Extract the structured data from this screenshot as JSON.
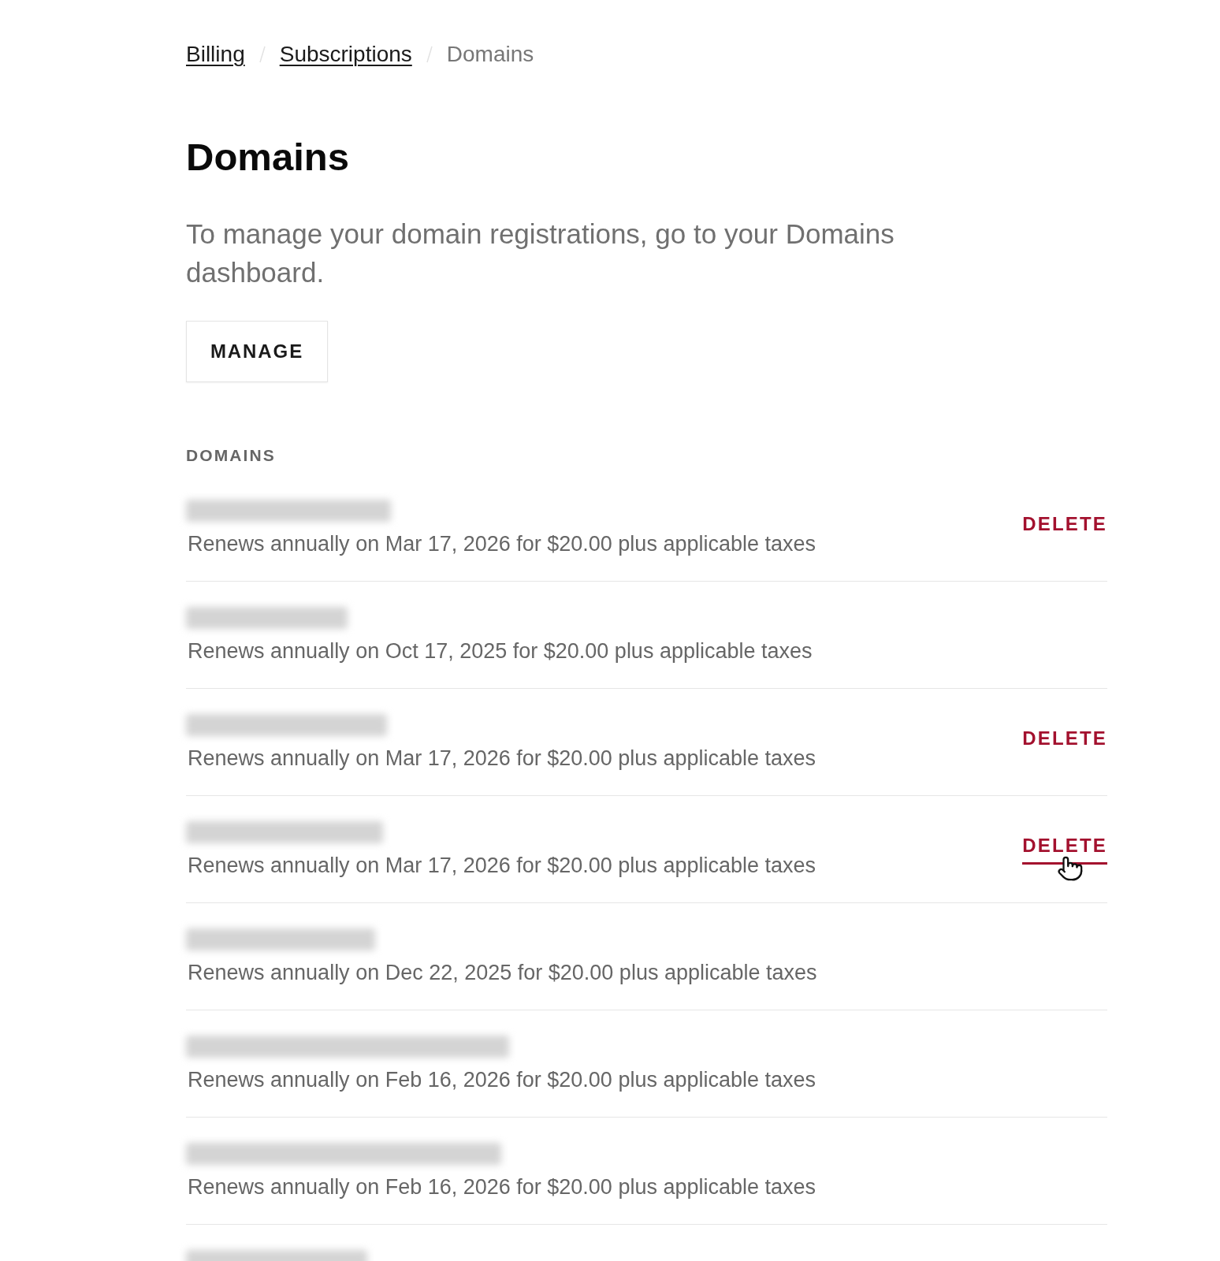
{
  "breadcrumbs": [
    {
      "label": "Billing",
      "link": true
    },
    {
      "label": "Subscriptions",
      "link": true
    },
    {
      "label": "Domains",
      "link": false
    }
  ],
  "page_title": "Domains",
  "description": "To manage your domain registrations, go to your Domains dashboard.",
  "manage_button": "MANAGE",
  "section_label": "DOMAINS",
  "domains": [
    {
      "renewal": "Renews annually on Mar 17, 2026 for $20.00 plus applicable taxes",
      "delete_label": "DELETE",
      "hovered": false
    },
    {
      "renewal": "Renews annually on Oct 17, 2025 for $20.00 plus applicable taxes"
    },
    {
      "renewal": "Renews annually on Mar 17, 2026 for $20.00 plus applicable taxes",
      "delete_label": "DELETE",
      "hovered": false
    },
    {
      "renewal": "Renews annually on Mar 17, 2026 for $20.00 plus applicable taxes",
      "delete_label": "DELETE",
      "hovered": true
    },
    {
      "renewal": "Renews annually on Dec 22, 2025 for $20.00 plus applicable taxes"
    },
    {
      "renewal": "Renews annually on Feb 16, 2026 for $20.00 plus applicable taxes"
    },
    {
      "renewal": "Renews annually on Feb 16, 2026 for $20.00 plus applicable taxes"
    },
    {
      "cut_off": true
    }
  ]
}
